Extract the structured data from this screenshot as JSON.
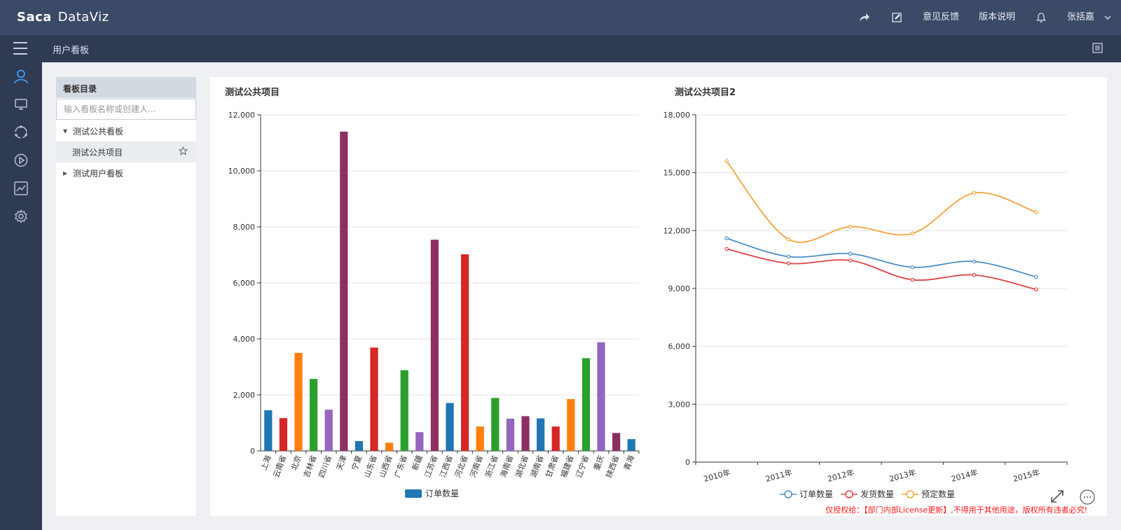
{
  "app": {
    "logo_brand": "Sa",
    "logo_mid": "ca",
    "logo_product": "DataViz"
  },
  "topbar": {
    "links": [
      "意见反馈",
      "版本说明"
    ],
    "user": "张括嘉",
    "icons": [
      "share-icon",
      "edit-icon",
      "bell-icon"
    ]
  },
  "subbar": {
    "breadcrumb": "用户看板",
    "icons": [
      "hamburger-icon",
      "list-icon"
    ]
  },
  "leftnav": {
    "icons": [
      "user-icon",
      "monitor-icon",
      "circle-icon",
      "play-icon",
      "chart-icon",
      "gear-icon"
    ]
  },
  "panel": {
    "title": "看板目录",
    "search_placeholder": "输入看板名称或创建人...",
    "tree": [
      {
        "label": "测试公共看板",
        "expanded": true
      },
      {
        "label": "测试公共项目",
        "selected": true
      },
      {
        "label": "测试用户看板",
        "expanded": false
      }
    ]
  },
  "watermark": "仅授权给：【部门内部License更新】,不得用于其他用途，版权所有违者必究!",
  "colors": {
    "accent": "#3d9bf3",
    "topbar": "#3b4a66",
    "nav": "#2f3a53"
  },
  "chart_data": [
    {
      "type": "bar",
      "title": "测试公共项目",
      "categories": [
        "上海",
        "云南省",
        "北京",
        "吉林省",
        "四川省",
        "天津",
        "宁夏",
        "山东省",
        "山西省",
        "广东省",
        "新疆",
        "江苏省",
        "江西省",
        "河北省",
        "河南省",
        "浙江省",
        "海南省",
        "湖北省",
        "湖南省",
        "甘肃省",
        "福建省",
        "辽宁省",
        "重庆",
        "陕西省",
        "青海"
      ],
      "series": [
        {
          "name": "订单数量",
          "values": [
            1450,
            1170,
            3500,
            2570,
            1470,
            11400,
            350,
            3690,
            290,
            2880,
            670,
            7540,
            1710,
            7020,
            870,
            1890,
            1150,
            1240,
            1160,
            870,
            1850,
            3310,
            3880,
            640,
            420
          ]
        }
      ],
      "colors": [
        "#1f77b4",
        "#d62728",
        "#ff7f0e",
        "#2ca02c",
        "#9467bd",
        "#8c3060"
      ],
      "ylim": [
        0,
        12000
      ],
      "yticks": [
        "0",
        "2,000",
        "4,000",
        "6,000",
        "8,000",
        "10,000",
        "12,000"
      ],
      "grid": true,
      "legend": "bottom-center"
    },
    {
      "type": "line",
      "title": "测试公共项目2",
      "categories": [
        "2010年",
        "2011年",
        "2012年",
        "2013年",
        "2014年",
        "2015年"
      ],
      "series": [
        {
          "name": "订单数量",
          "color": "#4b8ec9",
          "values": [
            11600,
            10650,
            10800,
            10100,
            10400,
            9600
          ]
        },
        {
          "name": "发货数量",
          "color": "#e04343",
          "values": [
            11050,
            10300,
            10450,
            9450,
            9700,
            8950
          ]
        },
        {
          "name": "预定数量",
          "color": "#f7a23b",
          "values": [
            15600,
            11550,
            12200,
            11850,
            13950,
            12950
          ]
        }
      ],
      "ylim": [
        0,
        18000
      ],
      "yticks": [
        "0",
        "3,000",
        "6,000",
        "9,000",
        "12,000",
        "15,000",
        "18,000"
      ],
      "grid": true,
      "legend": "bottom-right"
    }
  ]
}
